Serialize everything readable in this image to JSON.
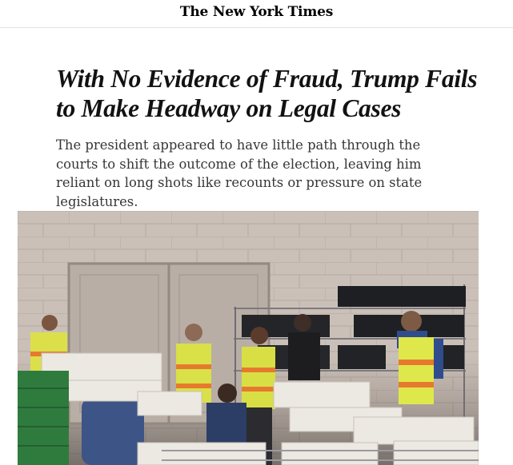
{
  "masthead": {
    "logo_text": "The New York Times"
  },
  "article": {
    "headline": "With No Evidence of Fraud, Trump Fails to Make Headway on Legal Cases",
    "summary": "The president appeared to have little path through the courts to shift the outcome of the election, leaving him reliant on long shots like recounts or pressure on state legislatures."
  },
  "photo": {
    "vest_colors": [
      "#e2e84a",
      "#e86a2a"
    ],
    "wall_color": "#c9beb6"
  }
}
